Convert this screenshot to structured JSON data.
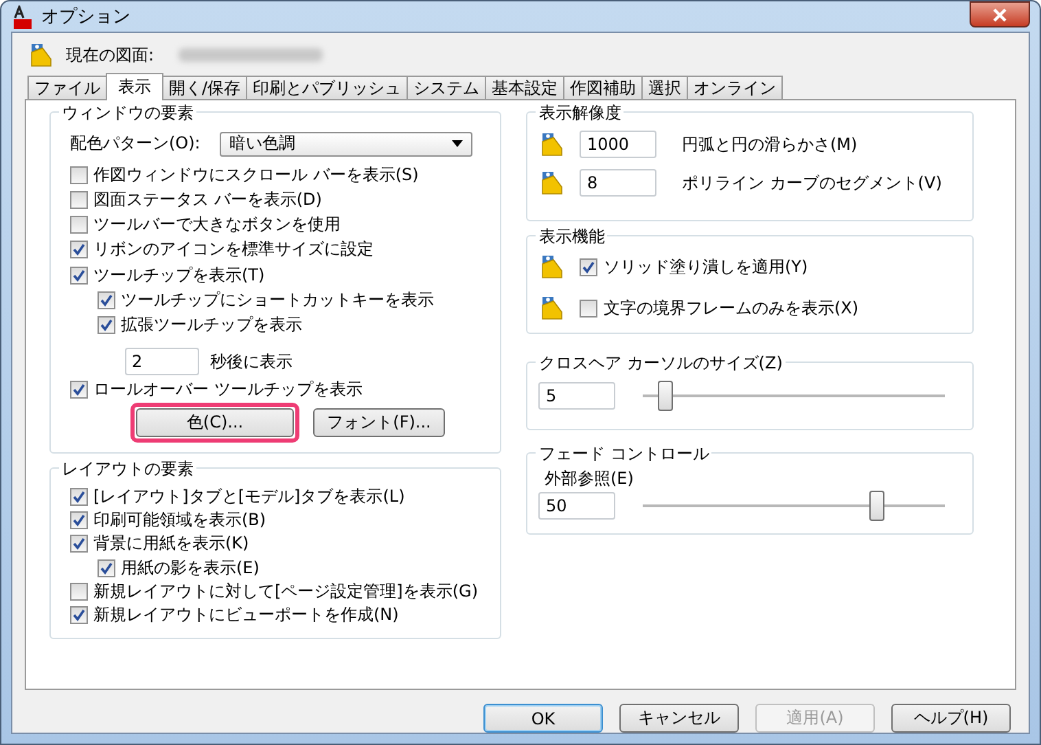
{
  "window": {
    "title": "オプション"
  },
  "current_drawing": {
    "label": "現在の図面:"
  },
  "tabs": [
    {
      "label": "ファイル",
      "selected": false
    },
    {
      "label": "表示",
      "selected": true
    },
    {
      "label": "開く/保存",
      "selected": false
    },
    {
      "label": "印刷とパブリッシュ",
      "selected": false
    },
    {
      "label": "システム",
      "selected": false
    },
    {
      "label": "基本設定",
      "selected": false
    },
    {
      "label": "作図補助",
      "selected": false
    },
    {
      "label": "選択",
      "selected": false
    },
    {
      "label": "オンライン",
      "selected": false
    }
  ],
  "window_elements": {
    "title": "ウィンドウの要素",
    "color_scheme": {
      "label": "配色パターン(O):",
      "value": "暗い色調"
    },
    "options": [
      {
        "kind": "checkbox",
        "label": "作図ウィンドウにスクロール バーを表示(S)",
        "checked": false
      },
      {
        "kind": "checkbox",
        "label": "図面ステータス バーを表示(D)",
        "checked": false
      },
      {
        "kind": "checkbox",
        "label": "ツールバーで大きなボタンを使用",
        "checked": false
      },
      {
        "kind": "checkbox",
        "label": "リボンのアイコンを標準サイズに設定",
        "checked": true
      },
      {
        "kind": "checkbox",
        "label": "ツールチップを表示(T)",
        "checked": true,
        "children": [
          {
            "kind": "checkbox",
            "label": "ツールチップにショートカットキーを表示",
            "checked": true
          },
          {
            "kind": "checkbox",
            "label": "拡張ツールチップを表示",
            "checked": true
          },
          {
            "kind": "field",
            "value": "2",
            "suffix": "秒後に表示"
          }
        ]
      },
      {
        "kind": "checkbox",
        "label": "ロールオーバー ツールチップを表示",
        "checked": true
      }
    ],
    "buttons": [
      {
        "label": "色(C)...",
        "highlighted": true
      },
      {
        "label": "フォント(F)...",
        "highlighted": false
      }
    ]
  },
  "layout_elements": {
    "title": "レイアウトの要素",
    "options": [
      {
        "kind": "checkbox",
        "label": "[レイアウト]タブと[モデル]タブを表示(L)",
        "checked": true
      },
      {
        "kind": "checkbox",
        "label": "印刷可能領域を表示(B)",
        "checked": true
      },
      {
        "kind": "checkbox",
        "label": "背景に用紙を表示(K)",
        "checked": true,
        "children": [
          {
            "kind": "checkbox",
            "label": "用紙の影を表示(E)",
            "checked": true
          }
        ]
      },
      {
        "kind": "checkbox",
        "label": "新規レイアウトに対して[ページ設定管理]を表示(G)",
        "checked": false
      },
      {
        "kind": "checkbox",
        "label": "新規レイアウトにビューポートを作成(N)",
        "checked": true
      }
    ]
  },
  "display_resolution": {
    "title": "表示解像度",
    "rows": [
      {
        "kind": "field",
        "value": "1000",
        "label": "円弧と円の滑らかさ(M)"
      },
      {
        "kind": "field",
        "value": "8",
        "label": "ポリライン カーブのセグメント(V)"
      }
    ]
  },
  "display_performance": {
    "title": "表示機能",
    "rows": [
      {
        "kind": "checkbox",
        "label": "ソリッド塗り潰しを適用(Y)",
        "checked": true
      },
      {
        "kind": "checkbox",
        "label": "文字の境界フレームのみを表示(X)",
        "checked": false
      }
    ]
  },
  "crosshair_size": {
    "title": "クロスヘア カーソルのサイズ(Z)",
    "value": "5",
    "level": 0.07
  },
  "fade_control": {
    "title": "フェード コントロール",
    "label": "外部参照(E)",
    "value": "50",
    "level": 0.77
  },
  "buttons": [
    {
      "label": "OK",
      "kind": "default",
      "disabled": false
    },
    {
      "label": "キャンセル",
      "kind": "normal",
      "disabled": false
    },
    {
      "label": "適用(A)",
      "kind": "normal",
      "disabled": true
    },
    {
      "label": "ヘルプ(H)",
      "kind": "normal",
      "disabled": false
    }
  ]
}
